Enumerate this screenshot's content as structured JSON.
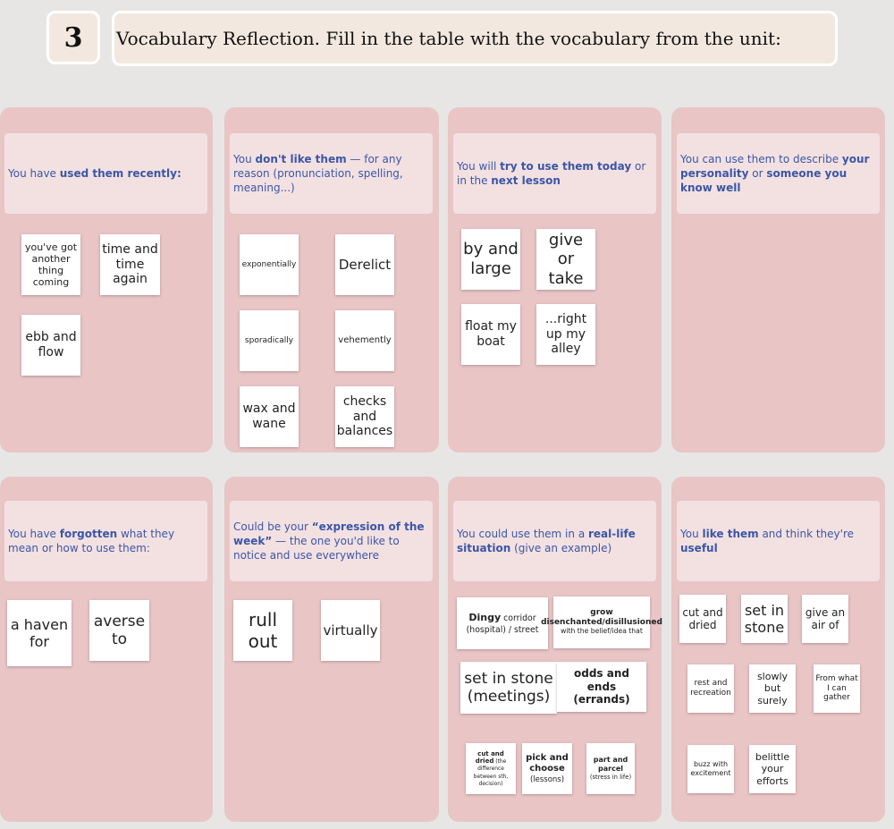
{
  "exercise": {
    "number": "3",
    "title": "Vocabulary Reflection. Fill in the table with the vocabulary from the unit:"
  },
  "columns": [
    {
      "header": [
        {
          "t": "You have ",
          "b": false
        },
        {
          "t": "used them recently:",
          "b": true
        }
      ],
      "notes": [
        "you've got another thing coming",
        "time and time again",
        "ebb and flow"
      ]
    },
    {
      "header": [
        {
          "t": "You ",
          "b": false
        },
        {
          "t": "don't like them",
          "b": true
        },
        {
          "t": " — for any reason (pronunciation, spelling, meaning...)",
          "b": false
        }
      ],
      "notes": [
        "exponentially",
        "Derelict",
        "sporadically",
        "vehemently",
        "wax and wane",
        "checks and balances"
      ]
    },
    {
      "header": [
        {
          "t": "You will ",
          "b": false
        },
        {
          "t": "try to use them today",
          "b": true
        },
        {
          "t": " or in the ",
          "b": false
        },
        {
          "t": "next lesson",
          "b": true
        }
      ],
      "notes": [
        "by and large",
        "give or take",
        "float my boat",
        "...right up my alley"
      ]
    },
    {
      "header": [
        {
          "t": "You can use them to describe ",
          "b": false
        },
        {
          "t": "your personality",
          "b": true
        },
        {
          "t": " or ",
          "b": false
        },
        {
          "t": "someone you know well",
          "b": true
        }
      ],
      "notes": []
    },
    {
      "header": [
        {
          "t": "You have ",
          "b": false
        },
        {
          "t": "forgotten",
          "b": true
        },
        {
          "t": " what they mean or how to use them:",
          "b": false
        }
      ],
      "notes": [
        "a haven for",
        "averse to"
      ]
    },
    {
      "header": [
        {
          "t": "Could be your ",
          "b": false
        },
        {
          "t": "“expression of the week”",
          "b": true
        },
        {
          "t": " — the one you'd like to notice and use everywhere",
          "b": false
        }
      ],
      "notes": [
        "rull out",
        "virtually"
      ]
    },
    {
      "header": [
        {
          "t": "You could use them in a ",
          "b": false
        },
        {
          "t": "real-life situation",
          "b": true
        },
        {
          "t": " (give an example)",
          "b": false
        }
      ],
      "notes": [
        {
          "parts": [
            {
              "t": "Dingy",
              "b": true
            },
            {
              "t": " corridor (hospital) / street",
              "b": false
            }
          ]
        },
        {
          "parts": [
            {
              "t": "grow disenchanted/disillusioned",
              "b": true
            },
            {
              "t": " with the belief/idea that",
              "b": false
            }
          ]
        },
        "set in stone (meetings)",
        {
          "parts": [
            {
              "t": "odds and ends (errands)",
              "b": true
            }
          ]
        },
        {
          "parts": [
            {
              "t": "cut and dried",
              "b": true
            },
            {
              "t": " (the difference between sth, decision)",
              "b": false
            }
          ]
        },
        {
          "parts": [
            {
              "t": "pick and choose",
              "b": true
            },
            {
              "t": " (lessons)",
              "b": false
            }
          ]
        },
        {
          "parts": [
            {
              "t": "part and parcel",
              "b": true
            },
            {
              "t": " (stress in life)",
              "b": false
            }
          ]
        }
      ]
    },
    {
      "header": [
        {
          "t": "You ",
          "b": false
        },
        {
          "t": "like them",
          "b": true
        },
        {
          "t": " and think they're ",
          "b": false
        },
        {
          "t": "useful",
          "b": true
        }
      ],
      "notes": [
        "cut and dried",
        "set in stone",
        "give an air of",
        "rest and recreation",
        "slowly but surely",
        "From what I can gather",
        "buzz with excitement",
        "belittle your efforts"
      ]
    }
  ]
}
